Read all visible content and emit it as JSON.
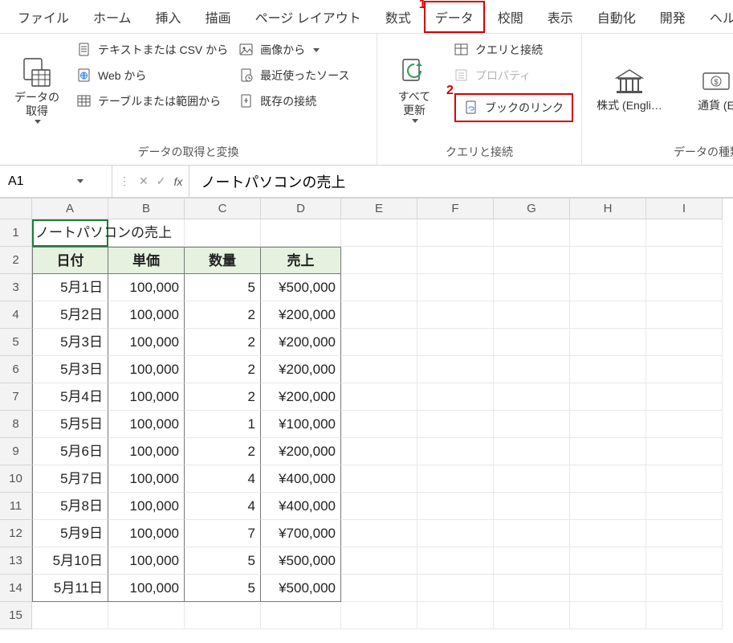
{
  "tabs": [
    "ファイル",
    "ホーム",
    "挿入",
    "描画",
    "ページ レイアウト",
    "数式",
    "データ",
    "校閲",
    "表示",
    "自動化",
    "開発",
    "ヘルプ"
  ],
  "active_tab_index": 6,
  "callouts": {
    "tab": "1",
    "booklink": "2"
  },
  "ribbon": {
    "group1": {
      "get_data": "データの\n取得",
      "from_text_csv": "テキストまたは CSV から",
      "from_web": "Web から",
      "from_table": "テーブルまたは範囲から",
      "from_image": "画像から",
      "recent_sources": "最近使ったソース",
      "existing_conn": "既存の接続",
      "label": "データの取得と変換"
    },
    "group2": {
      "refresh_all": "すべて\n更新",
      "queries": "クエリと接続",
      "properties": "プロパティ",
      "booklink": "ブックのリンク",
      "label": "クエリと接続"
    },
    "group3": {
      "stocks": "株式 (Engli…",
      "currency": "通貨 (E",
      "label": "データの種類"
    }
  },
  "formula_bar": {
    "cell_ref": "A1",
    "value": "ノートパソコンの売上"
  },
  "sheet": {
    "cols": [
      "A",
      "B",
      "C",
      "D",
      "E",
      "F",
      "G",
      "H",
      "I"
    ],
    "title": "ノートパソコンの売上",
    "headers": [
      "日付",
      "単価",
      "数量",
      "売上"
    ],
    "rows": [
      {
        "date": "5月1日",
        "unit": "100,000",
        "qty": "5",
        "sales": "¥500,000"
      },
      {
        "date": "5月2日",
        "unit": "100,000",
        "qty": "2",
        "sales": "¥200,000"
      },
      {
        "date": "5月3日",
        "unit": "100,000",
        "qty": "2",
        "sales": "¥200,000"
      },
      {
        "date": "5月3日",
        "unit": "100,000",
        "qty": "2",
        "sales": "¥200,000"
      },
      {
        "date": "5月4日",
        "unit": "100,000",
        "qty": "2",
        "sales": "¥200,000"
      },
      {
        "date": "5月5日",
        "unit": "100,000",
        "qty": "1",
        "sales": "¥100,000"
      },
      {
        "date": "5月6日",
        "unit": "100,000",
        "qty": "2",
        "sales": "¥200,000"
      },
      {
        "date": "5月7日",
        "unit": "100,000",
        "qty": "4",
        "sales": "¥400,000"
      },
      {
        "date": "5月8日",
        "unit": "100,000",
        "qty": "4",
        "sales": "¥400,000"
      },
      {
        "date": "5月9日",
        "unit": "100,000",
        "qty": "7",
        "sales": "¥700,000"
      },
      {
        "date": "5月10日",
        "unit": "100,000",
        "qty": "5",
        "sales": "¥500,000"
      },
      {
        "date": "5月11日",
        "unit": "100,000",
        "qty": "5",
        "sales": "¥500,000"
      }
    ]
  }
}
